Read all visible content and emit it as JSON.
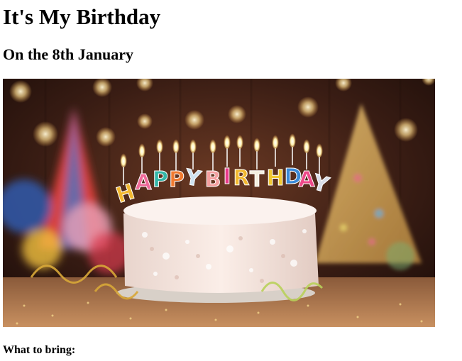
{
  "page": {
    "title": "It's My Birthday",
    "subtitle": "On the 8th January",
    "section_heading": "What to bring:"
  },
  "hero_image": {
    "depicts": "birthday-cake-photo",
    "candle_letters": [
      "H",
      "A",
      "P",
      "P",
      "Y",
      "B",
      "I",
      "R",
      "T",
      "H",
      "D",
      "A",
      "Y"
    ]
  },
  "colors": {
    "text": "#000000",
    "background": "#ffffff"
  }
}
